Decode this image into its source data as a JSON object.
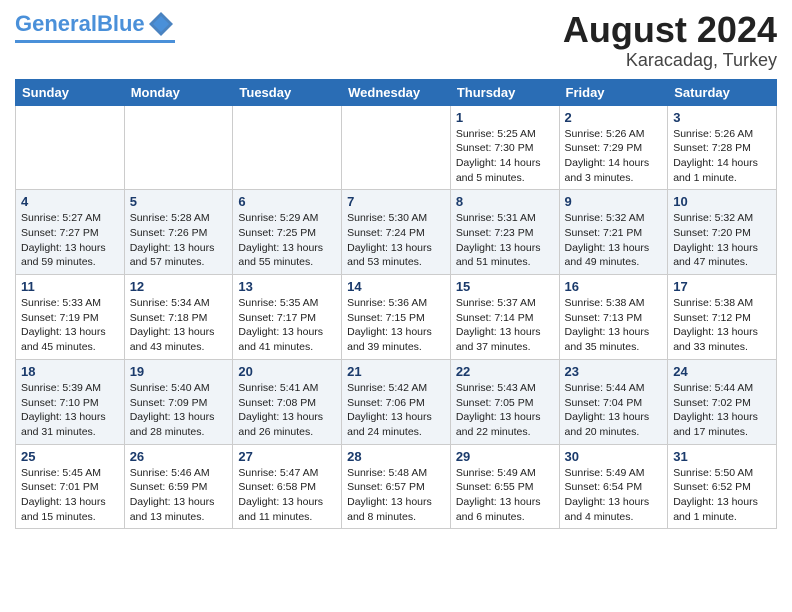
{
  "header": {
    "logo_general": "General",
    "logo_blue": "Blue",
    "month": "August 2024",
    "location": "Karacadag, Turkey"
  },
  "weekdays": [
    "Sunday",
    "Monday",
    "Tuesday",
    "Wednesday",
    "Thursday",
    "Friday",
    "Saturday"
  ],
  "weeks": [
    [
      {
        "day": "",
        "info": ""
      },
      {
        "day": "",
        "info": ""
      },
      {
        "day": "",
        "info": ""
      },
      {
        "day": "",
        "info": ""
      },
      {
        "day": "1",
        "info": "Sunrise: 5:25 AM\nSunset: 7:30 PM\nDaylight: 14 hours\nand 5 minutes."
      },
      {
        "day": "2",
        "info": "Sunrise: 5:26 AM\nSunset: 7:29 PM\nDaylight: 14 hours\nand 3 minutes."
      },
      {
        "day": "3",
        "info": "Sunrise: 5:26 AM\nSunset: 7:28 PM\nDaylight: 14 hours\nand 1 minute."
      }
    ],
    [
      {
        "day": "4",
        "info": "Sunrise: 5:27 AM\nSunset: 7:27 PM\nDaylight: 13 hours\nand 59 minutes."
      },
      {
        "day": "5",
        "info": "Sunrise: 5:28 AM\nSunset: 7:26 PM\nDaylight: 13 hours\nand 57 minutes."
      },
      {
        "day": "6",
        "info": "Sunrise: 5:29 AM\nSunset: 7:25 PM\nDaylight: 13 hours\nand 55 minutes."
      },
      {
        "day": "7",
        "info": "Sunrise: 5:30 AM\nSunset: 7:24 PM\nDaylight: 13 hours\nand 53 minutes."
      },
      {
        "day": "8",
        "info": "Sunrise: 5:31 AM\nSunset: 7:23 PM\nDaylight: 13 hours\nand 51 minutes."
      },
      {
        "day": "9",
        "info": "Sunrise: 5:32 AM\nSunset: 7:21 PM\nDaylight: 13 hours\nand 49 minutes."
      },
      {
        "day": "10",
        "info": "Sunrise: 5:32 AM\nSunset: 7:20 PM\nDaylight: 13 hours\nand 47 minutes."
      }
    ],
    [
      {
        "day": "11",
        "info": "Sunrise: 5:33 AM\nSunset: 7:19 PM\nDaylight: 13 hours\nand 45 minutes."
      },
      {
        "day": "12",
        "info": "Sunrise: 5:34 AM\nSunset: 7:18 PM\nDaylight: 13 hours\nand 43 minutes."
      },
      {
        "day": "13",
        "info": "Sunrise: 5:35 AM\nSunset: 7:17 PM\nDaylight: 13 hours\nand 41 minutes."
      },
      {
        "day": "14",
        "info": "Sunrise: 5:36 AM\nSunset: 7:15 PM\nDaylight: 13 hours\nand 39 minutes."
      },
      {
        "day": "15",
        "info": "Sunrise: 5:37 AM\nSunset: 7:14 PM\nDaylight: 13 hours\nand 37 minutes."
      },
      {
        "day": "16",
        "info": "Sunrise: 5:38 AM\nSunset: 7:13 PM\nDaylight: 13 hours\nand 35 minutes."
      },
      {
        "day": "17",
        "info": "Sunrise: 5:38 AM\nSunset: 7:12 PM\nDaylight: 13 hours\nand 33 minutes."
      }
    ],
    [
      {
        "day": "18",
        "info": "Sunrise: 5:39 AM\nSunset: 7:10 PM\nDaylight: 13 hours\nand 31 minutes."
      },
      {
        "day": "19",
        "info": "Sunrise: 5:40 AM\nSunset: 7:09 PM\nDaylight: 13 hours\nand 28 minutes."
      },
      {
        "day": "20",
        "info": "Sunrise: 5:41 AM\nSunset: 7:08 PM\nDaylight: 13 hours\nand 26 minutes."
      },
      {
        "day": "21",
        "info": "Sunrise: 5:42 AM\nSunset: 7:06 PM\nDaylight: 13 hours\nand 24 minutes."
      },
      {
        "day": "22",
        "info": "Sunrise: 5:43 AM\nSunset: 7:05 PM\nDaylight: 13 hours\nand 22 minutes."
      },
      {
        "day": "23",
        "info": "Sunrise: 5:44 AM\nSunset: 7:04 PM\nDaylight: 13 hours\nand 20 minutes."
      },
      {
        "day": "24",
        "info": "Sunrise: 5:44 AM\nSunset: 7:02 PM\nDaylight: 13 hours\nand 17 minutes."
      }
    ],
    [
      {
        "day": "25",
        "info": "Sunrise: 5:45 AM\nSunset: 7:01 PM\nDaylight: 13 hours\nand 15 minutes."
      },
      {
        "day": "26",
        "info": "Sunrise: 5:46 AM\nSunset: 6:59 PM\nDaylight: 13 hours\nand 13 minutes."
      },
      {
        "day": "27",
        "info": "Sunrise: 5:47 AM\nSunset: 6:58 PM\nDaylight: 13 hours\nand 11 minutes."
      },
      {
        "day": "28",
        "info": "Sunrise: 5:48 AM\nSunset: 6:57 PM\nDaylight: 13 hours\nand 8 minutes."
      },
      {
        "day": "29",
        "info": "Sunrise: 5:49 AM\nSunset: 6:55 PM\nDaylight: 13 hours\nand 6 minutes."
      },
      {
        "day": "30",
        "info": "Sunrise: 5:49 AM\nSunset: 6:54 PM\nDaylight: 13 hours\nand 4 minutes."
      },
      {
        "day": "31",
        "info": "Sunrise: 5:50 AM\nSunset: 6:52 PM\nDaylight: 13 hours\nand 1 minute."
      }
    ]
  ]
}
